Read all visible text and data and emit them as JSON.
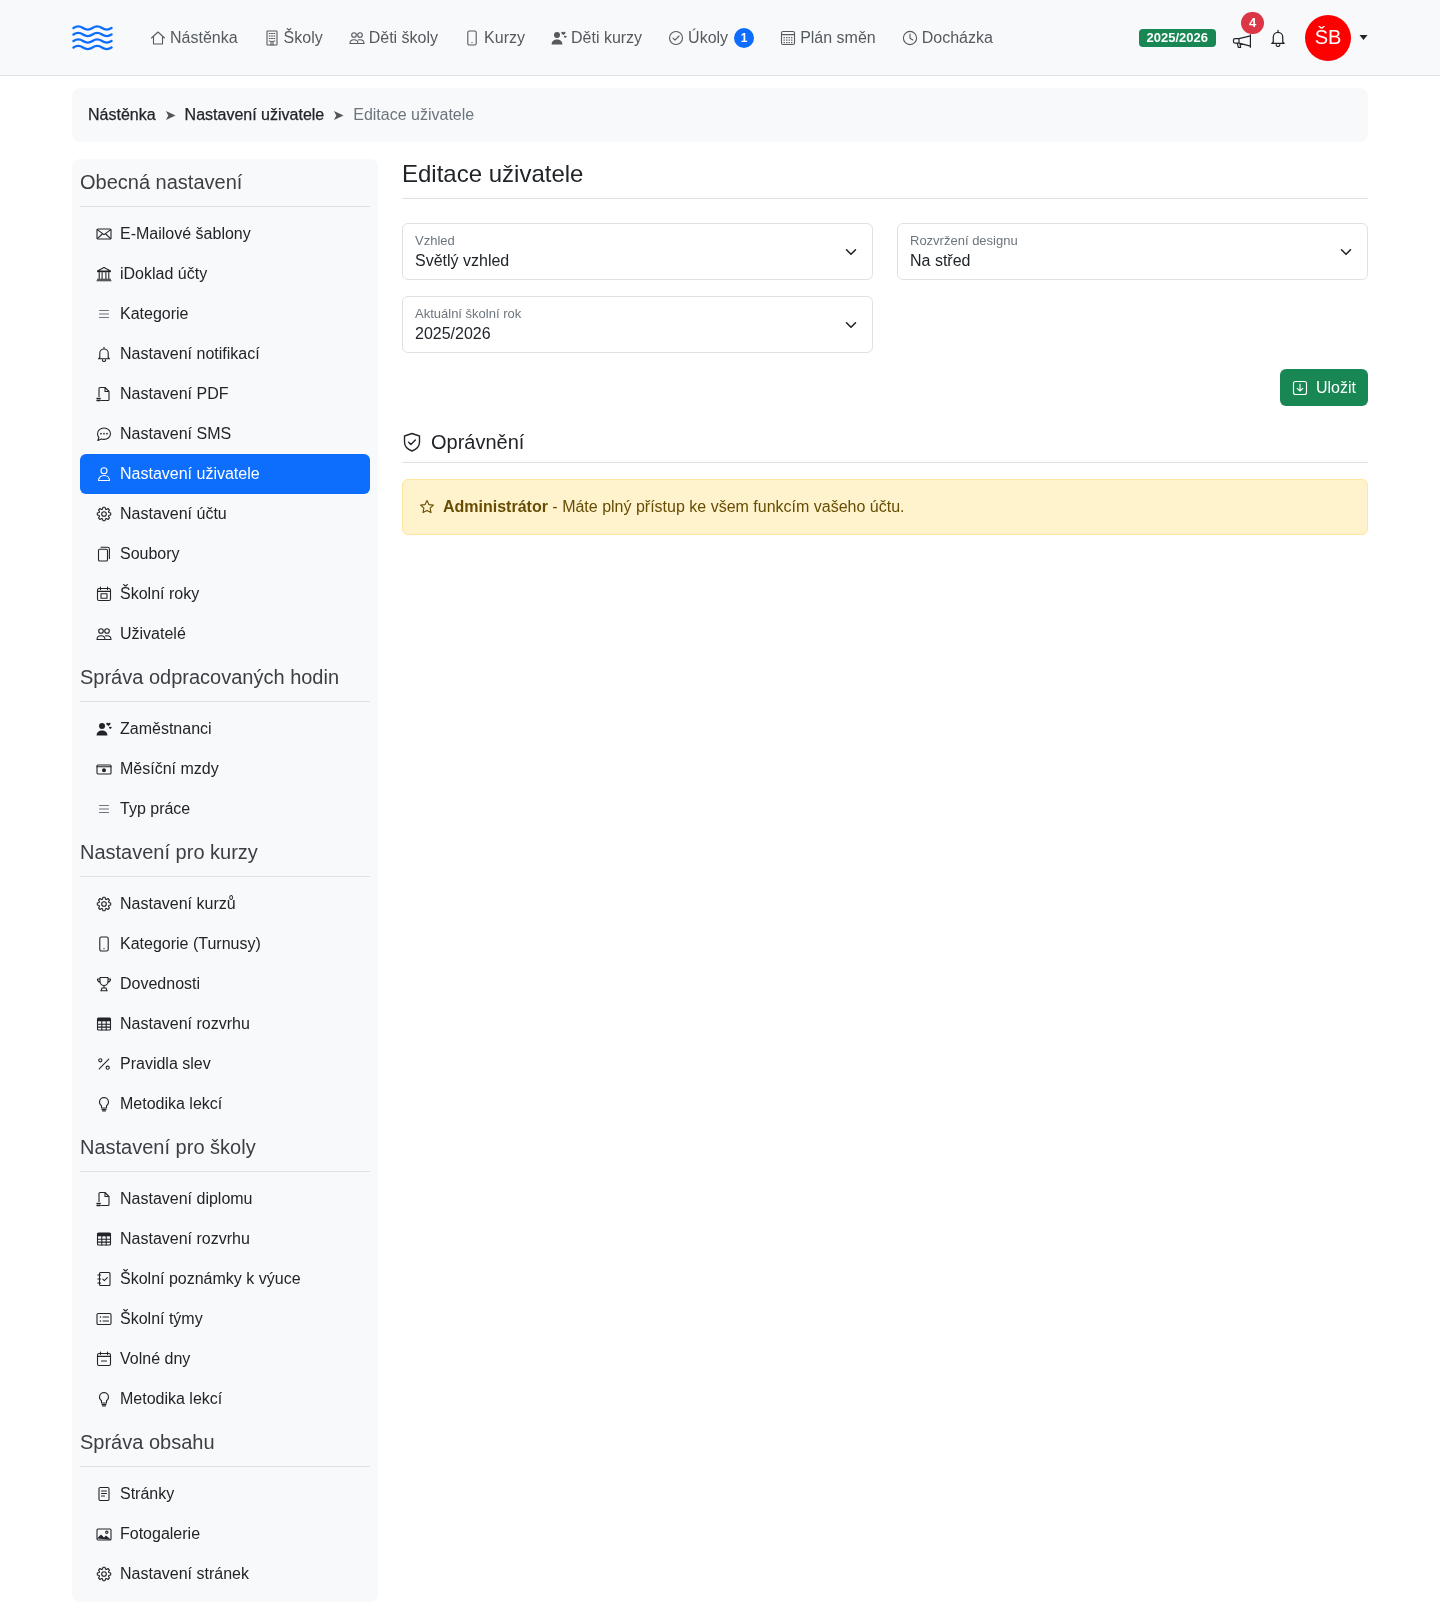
{
  "navbar": {
    "items": [
      {
        "label": "Nástěnka"
      },
      {
        "label": "Školy"
      },
      {
        "label": "Děti školy"
      },
      {
        "label": "Kurzy"
      },
      {
        "label": "Děti kurzy"
      },
      {
        "label": "Úkoly",
        "badge": "1"
      },
      {
        "label": "Plán směn"
      },
      {
        "label": "Docházka"
      }
    ],
    "school_year": "2025/2026",
    "announcements_badge": "4",
    "avatar_initials": "ŠB"
  },
  "breadcrumb": [
    {
      "label": "Nástěnka",
      "current": false
    },
    {
      "label": "Nastavení uživatele",
      "current": false
    },
    {
      "label": "Editace uživatele",
      "current": true
    }
  ],
  "sidebar": {
    "sections": [
      {
        "title": "Obecná nastavení",
        "items": [
          {
            "label": "E-Mailové šablony",
            "selected": false
          },
          {
            "label": "iDoklad účty",
            "selected": false
          },
          {
            "label": "Kategorie",
            "selected": false
          },
          {
            "label": "Nastavení notifikací",
            "selected": false
          },
          {
            "label": "Nastavení PDF",
            "selected": false
          },
          {
            "label": "Nastavení SMS",
            "selected": false
          },
          {
            "label": "Nastavení uživatele",
            "selected": true
          },
          {
            "label": "Nastavení účtu",
            "selected": false
          },
          {
            "label": "Soubory",
            "selected": false
          },
          {
            "label": "Školní roky",
            "selected": false
          },
          {
            "label": "Uživatelé",
            "selected": false
          }
        ]
      },
      {
        "title": "Správa odpracovaných hodin",
        "items": [
          {
            "label": "Zaměstnanci",
            "selected": false
          },
          {
            "label": "Měsíční mzdy",
            "selected": false
          },
          {
            "label": "Typ práce",
            "selected": false
          }
        ]
      },
      {
        "title": "Nastavení pro kurzy",
        "items": [
          {
            "label": "Nastavení kurzů",
            "selected": false
          },
          {
            "label": "Kategorie (Turnusy)",
            "selected": false
          },
          {
            "label": "Dovednosti",
            "selected": false
          },
          {
            "label": "Nastavení rozvrhu",
            "selected": false
          },
          {
            "label": "Pravidla slev",
            "selected": false
          },
          {
            "label": "Metodika lekcí",
            "selected": false
          }
        ]
      },
      {
        "title": "Nastavení pro školy",
        "items": [
          {
            "label": "Nastavení diplomu",
            "selected": false
          },
          {
            "label": "Nastavení rozvrhu",
            "selected": false
          },
          {
            "label": "Školní poznámky k výuce",
            "selected": false
          },
          {
            "label": "Školní týmy",
            "selected": false
          },
          {
            "label": "Volné dny",
            "selected": false
          },
          {
            "label": "Metodika lekcí",
            "selected": false
          }
        ]
      },
      {
        "title": "Správa obsahu",
        "items": [
          {
            "label": "Stránky",
            "selected": false
          },
          {
            "label": "Fotogalerie",
            "selected": false
          },
          {
            "label": "Nastavení stránek",
            "selected": false
          }
        ]
      }
    ]
  },
  "main": {
    "title": "Editace uživatele",
    "fields": [
      {
        "label": "Vzhled",
        "value": "Světlý vzhled"
      },
      {
        "label": "Rozvržení designu",
        "value": "Na střed"
      },
      {
        "label": "Aktuální školní rok",
        "value": "2025/2026"
      }
    ],
    "save_button": "Uložit",
    "permissions": {
      "title": "Oprávnění",
      "alert": "**Administrátor** - Máte plný přístup ke všem funkcím vašeho účtu."
    }
  }
}
